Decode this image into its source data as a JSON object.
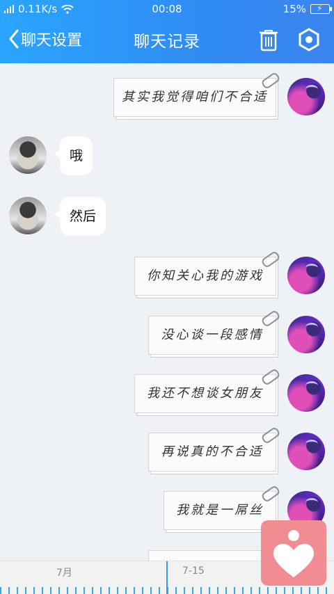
{
  "status": {
    "signal": "0.11K/s",
    "time": "00:08",
    "battery": "15%"
  },
  "nav": {
    "back_label": "聊天设置",
    "title": "聊天记录"
  },
  "messages": [
    {
      "side": "right",
      "text": "其实我觉得咱们不合适"
    },
    {
      "side": "left",
      "text": "哦"
    },
    {
      "side": "left",
      "text": "然后"
    },
    {
      "side": "right",
      "text": "你知关心我的游戏"
    },
    {
      "side": "right",
      "text": "没心谈一段感情"
    },
    {
      "side": "right",
      "text": "我还不想谈女朋友"
    },
    {
      "side": "right",
      "text": "再说真的不合适"
    },
    {
      "side": "right",
      "text": "我就是一屌丝"
    }
  ],
  "timeline": {
    "labels": [
      "7月",
      "7-15"
    ]
  },
  "colors": {
    "header": "#2f8cf3",
    "fab": "#f08c92",
    "timeline_tick": "#39a6ee"
  }
}
